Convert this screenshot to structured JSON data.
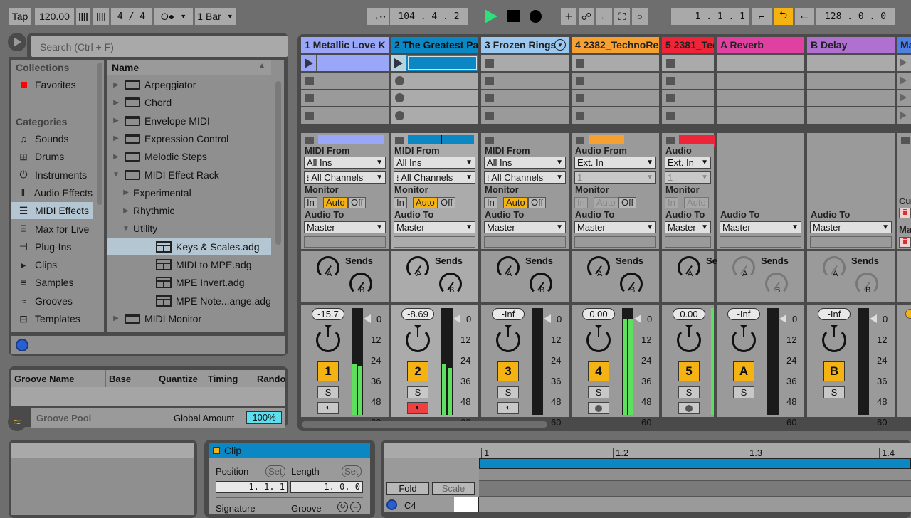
{
  "transport": {
    "tap": "Tap",
    "tempo": "120.00",
    "nudge_down": "||||",
    "nudge_up": "||||",
    "signature": "4 / 4",
    "metronome": "O●",
    "quantize": "1 Bar",
    "follow_icon": "→··",
    "position": "104 .   4 .   2",
    "loop_start": "1 .   1 .   1",
    "loop_length": "128 .   0 .   0",
    "punch_in_icon": "punch-in",
    "loop_icon": "loop",
    "punch_out_icon": "punch-out",
    "accent_play": "#2fe07a",
    "accent_loop": "#f5b313"
  },
  "browser": {
    "search_placeholder": "Search (Ctrl + F)",
    "collections_header": "Collections",
    "favorites": "Favorites",
    "categories_header": "Categories",
    "categories": [
      {
        "label": "Sounds",
        "icon": "♫"
      },
      {
        "label": "Drums",
        "icon": "⊞"
      },
      {
        "label": "Instruments",
        "icon": "⏻"
      },
      {
        "label": "Audio Effects",
        "icon": "‖"
      },
      {
        "label": "MIDI Effects",
        "icon": "☰"
      },
      {
        "label": "Max for Live",
        "icon": "⌸"
      },
      {
        "label": "Plug-Ins",
        "icon": "⊣"
      },
      {
        "label": "Clips",
        "icon": "▸"
      },
      {
        "label": "Samples",
        "icon": "≡"
      },
      {
        "label": "Grooves",
        "icon": "≈"
      },
      {
        "label": "Templates",
        "icon": "⊟"
      }
    ],
    "name_header": "Name",
    "items": [
      {
        "label": "Arpeggiator",
        "type": "device"
      },
      {
        "label": "Chord",
        "type": "device"
      },
      {
        "label": "Envelope MIDI",
        "type": "m4l"
      },
      {
        "label": "Expression Control",
        "type": "m4l"
      },
      {
        "label": "Melodic Steps",
        "type": "m4l"
      },
      {
        "label": "MIDI Effect Rack",
        "type": "device"
      },
      {
        "label": "Experimental",
        "type": "folder"
      },
      {
        "label": "Rhythmic",
        "type": "folder"
      },
      {
        "label": "Utility",
        "type": "folder"
      },
      {
        "label": "Keys & Scales.adg",
        "type": "adg"
      },
      {
        "label": "MIDI to MPE.adg",
        "type": "adg"
      },
      {
        "label": "MPE Invert.adg",
        "type": "adg"
      },
      {
        "label": "MPE Note...ange.adg",
        "type": "adg"
      },
      {
        "label": "MIDI Monitor",
        "type": "m4l"
      }
    ]
  },
  "groove_pool": {
    "columns": [
      "Groove Name",
      "Base",
      "Quantize",
      "Timing",
      "Rando"
    ],
    "title": "Groove Pool",
    "global_amount_label": "Global Amount",
    "global_amount": "100%"
  },
  "tracks": [
    {
      "name": "1 Metallic Love K",
      "color": "#9aa6f8",
      "type": "midi",
      "from": "All Ins",
      "channel": "All Channels",
      "to": "Master",
      "volume": "-15.7",
      "number": "1",
      "arm_active": false,
      "meter_l": 0.48,
      "meter_r": 0.46
    },
    {
      "name": "2 The Greatest Pa",
      "color": "#0b88c4",
      "type": "midi",
      "from": "All Ins",
      "channel": "All Channels",
      "to": "Master",
      "volume": "-8.69",
      "number": "2",
      "arm_active": true,
      "meter_l": 0.48,
      "meter_r": 0.44
    },
    {
      "name": "3 Frozen Rings",
      "color": "#9cc8f0",
      "type": "midi",
      "from": "All Ins",
      "channel": "All Channels",
      "to": "Master",
      "volume": "-Inf",
      "number": "3",
      "arm_active": false,
      "meter_l": 0,
      "meter_r": 0
    },
    {
      "name": "4 2382_TechnoRe",
      "color": "#f5a030",
      "type": "audio",
      "from": "Ext. In",
      "channel": "1",
      "to": "Master",
      "volume": "0.00",
      "number": "4",
      "arm_active": false,
      "meter_l": 0.9,
      "meter_r": 0.9
    },
    {
      "name": "5 2381_Tec",
      "color": "#ee2438",
      "type": "audio",
      "from": "Ext. In",
      "channel": "1",
      "to": "Master",
      "volume": "0.00",
      "number": "5",
      "arm_active": false,
      "meter_l": 0.9,
      "meter_r": 0
    },
    {
      "name": "A Reverb",
      "color": "#e040a0",
      "type": "return",
      "to": "Master",
      "volume": "-Inf",
      "number": "A"
    },
    {
      "name": "B Delay",
      "color": "#b070d0",
      "type": "return",
      "to": "Master",
      "volume": "-Inf",
      "number": "B"
    },
    {
      "name": "Ma",
      "color": "#5080e0",
      "type": "master"
    }
  ],
  "io_labels": {
    "midi_from": "MIDI From",
    "audio_from": "Audio From",
    "monitor": "Monitor",
    "audio_to": "Audio To",
    "in": "In",
    "auto": "Auto",
    "off": "Off",
    "sends": "Sends",
    "send_a": "A",
    "send_b": "B",
    "solo": "S",
    "cue_label": "Cu",
    "master_label": "Ma"
  },
  "meter_scale": [
    "0",
    "12",
    "24",
    "36",
    "48",
    "60"
  ],
  "clip": {
    "title": "Clip",
    "position_label": "Position",
    "length_label": "Length",
    "set_label": "Set",
    "position_value": "1.   1.   1",
    "length_value": "1.   0.   0",
    "signature_label": "Signature",
    "groove_label": "Groove"
  },
  "piano_roll": {
    "fold": "Fold",
    "scale": "Scale",
    "note": "C4",
    "ruler": [
      "1",
      "1.2",
      "1.3",
      "1.4"
    ]
  }
}
